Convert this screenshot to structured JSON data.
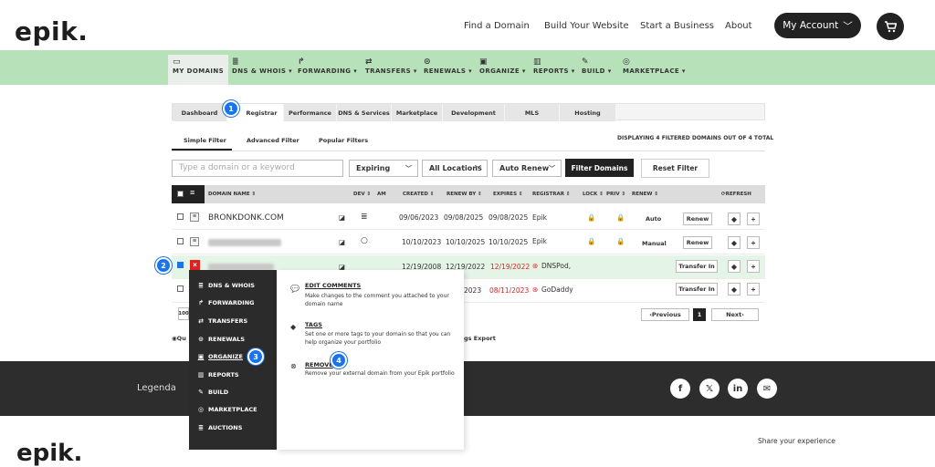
{
  "brand": {
    "logo": "epik."
  },
  "top_nav": {
    "links": [
      "Find a Domain",
      "Build Your Website",
      "Start a Business",
      "About"
    ],
    "account_label": "My Account"
  },
  "main_nav": [
    {
      "label": "MY DOMAINS",
      "icon": "folder-icon"
    },
    {
      "label": "DNS & WHOIS ▾",
      "icon": "list-icon"
    },
    {
      "label": "FORWARDING ▾",
      "icon": "forward-icon"
    },
    {
      "label": "TRANSFERS ▾",
      "icon": "transfer-icon"
    },
    {
      "label": "RENEWALS ▾",
      "icon": "clock-icon"
    },
    {
      "label": "ORGANIZE ▾",
      "icon": "briefcase-icon"
    },
    {
      "label": "REPORTS ▾",
      "icon": "chart-icon"
    },
    {
      "label": "BUILD ▾",
      "icon": "wrench-icon"
    },
    {
      "label": "MARKETPLACE ▾",
      "icon": "market-icon"
    }
  ],
  "tabs": [
    "Dashboard",
    "Registrar",
    "Performance",
    "DNS & Services",
    "Marketplace",
    "Development",
    "MLS",
    "Hosting"
  ],
  "filter_tabs": [
    "Simple Filter",
    "Advanced Filter",
    "Popular Filters"
  ],
  "displaying": "DISPLAYING 4 FILTERED DOMAINS OUT OF 4 TOTAL",
  "search": {
    "placeholder": "Type a domain or a keyword"
  },
  "selects": {
    "expiring": "Expiring",
    "locations": "All Locations",
    "auto_renew": "Auto Renew"
  },
  "buttons": {
    "filter": "Filter Domains",
    "reset": "Reset Filter",
    "previous": "‹Previous",
    "page": "1",
    "next": "Next›"
  },
  "columns": {
    "domain": "DOMAIN NAME ⇕",
    "dev": "DEV ⇕",
    "am": "AM",
    "created": "CREATED ⇕",
    "renew_by": "RENEW BY ⇕",
    "expires": "EXPIRES ⇕",
    "registrar": "REGISTRAR ⇕",
    "lock": "LOCK ⇕",
    "priv": "PRIV ⇕",
    "renew": "RENEW ⇕",
    "refresh": "⟳REFRESH"
  },
  "rows": [
    {
      "domain": "BRONKDONK.COM",
      "created": "09/06/2023",
      "renew_by": "09/08/2025",
      "expires": "09/08/2025",
      "registrar": "Epik",
      "renew": "Auto",
      "action": "Renew"
    },
    {
      "domain": "",
      "created": "10/10/2023",
      "renew_by": "10/10/2025",
      "expires": "10/10/2025",
      "registrar": "Epik",
      "renew": "Manual",
      "action": "Renew"
    },
    {
      "domain": "",
      "created": "12/19/2008",
      "renew_by": "12/19/2022",
      "expires": "12/19/2022",
      "registrar": "DNSPod,",
      "renew": "",
      "action": "Transfer In"
    },
    {
      "domain": "",
      "created": "2023",
      "renew_by": "",
      "expires": "08/11/2023",
      "registrar": "GoDaddy",
      "renew": "",
      "action": "Transfer In"
    }
  ],
  "page_size": "100",
  "below_table": {
    "left": "Qu",
    "right": "gs Export"
  },
  "dropdown_menu": [
    {
      "label": "DNS & WHOIS",
      "icon": "list-icon"
    },
    {
      "label": "FORWARDING",
      "icon": "forward-icon"
    },
    {
      "label": "TRANSFERS",
      "icon": "transfer-icon"
    },
    {
      "label": "RENEWALS",
      "icon": "clock-icon"
    },
    {
      "label": "ORGANIZE",
      "icon": "briefcase-icon"
    },
    {
      "label": "REPORTS",
      "icon": "chart-icon"
    },
    {
      "label": "BUILD",
      "icon": "wrench-icon"
    },
    {
      "label": "MARKETPLACE",
      "icon": "market-icon"
    },
    {
      "label": "AUCTIONS",
      "icon": "list-icon"
    }
  ],
  "submenu": [
    {
      "title": "EDIT COMMENTS",
      "desc": "Make changes to the comment you attached to your domain name",
      "icon": "comment-icon"
    },
    {
      "title": "TAGS",
      "desc": "Set one or more tags to your domain so that you can help organize your portfolio",
      "icon": "tag-icon"
    },
    {
      "title": "REMOVE",
      "desc": "Remove your external domain from your Epik portfolio",
      "icon": "remove-icon"
    }
  ],
  "step_badges": [
    "1",
    "2",
    "3",
    "4"
  ],
  "footer": {
    "legend": "Legenda",
    "share": "Share your experience",
    "social": [
      "f",
      "𝕏",
      "in",
      "✉"
    ]
  },
  "colors": {
    "nav_green": "#b7e2b9",
    "badge_blue": "#1a73e8",
    "expired_red": "#e02020",
    "footer_dark": "#2d2d2d"
  }
}
